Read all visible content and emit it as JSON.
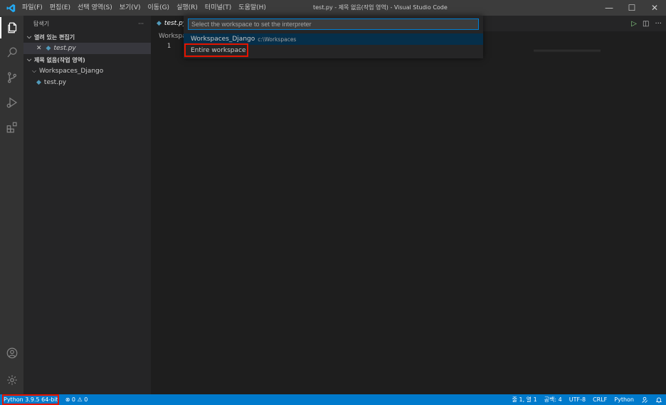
{
  "window": {
    "title": "test.py - 제목 없음(작업 영역) - Visual Studio Code",
    "controls": {
      "minimize": "—",
      "maximize": "☐",
      "close": "✕"
    }
  },
  "menu": [
    {
      "label": "파일(F)"
    },
    {
      "label": "편집(E)"
    },
    {
      "label": "선택 영역(S)"
    },
    {
      "label": "보기(V)"
    },
    {
      "label": "이동(G)"
    },
    {
      "label": "실행(R)"
    },
    {
      "label": "터미널(T)"
    },
    {
      "label": "도움말(H)"
    }
  ],
  "activity_bar": {
    "icons": [
      "files-icon",
      "search-icon",
      "source-control-icon",
      "run-debug-icon",
      "extensions-icon",
      "account-icon",
      "settings-gear-icon"
    ]
  },
  "sidebar": {
    "title": "탐색기",
    "more": "···",
    "open_editors": {
      "header": "열려 있는 편집기",
      "items": [
        {
          "close": "✕",
          "label": "test.py"
        }
      ]
    },
    "workspace": {
      "header": "제목 없음(작업 영역)",
      "folder": "Workspaces_Django",
      "files": [
        {
          "label": "test.py"
        }
      ]
    }
  },
  "editor": {
    "tab": {
      "label": "test.py"
    },
    "breadcrumb": "Workspac",
    "line_numbers": [
      "1"
    ],
    "actions": {
      "run": "▷",
      "split": "◫",
      "more": "···"
    }
  },
  "quick_pick": {
    "placeholder": "Select the workspace to set the interpreter",
    "value": "",
    "items": [
      {
        "label": "Workspaces_Django",
        "description": "c:\\Workspaces"
      },
      {
        "label": "Entire workspace",
        "description": ""
      }
    ]
  },
  "status_bar": {
    "interpreter": "Python 3.9.5 64-bit",
    "problems": "⊗ 0 ⚠ 0",
    "position": "줄 1, 열 1",
    "spaces": "공백: 4",
    "encoding": "UTF-8",
    "eol": "CRLF",
    "language": "Python"
  },
  "colors": {
    "accent": "#007acc",
    "highlight_box": "#e51400",
    "python_icon": "#519aba"
  }
}
